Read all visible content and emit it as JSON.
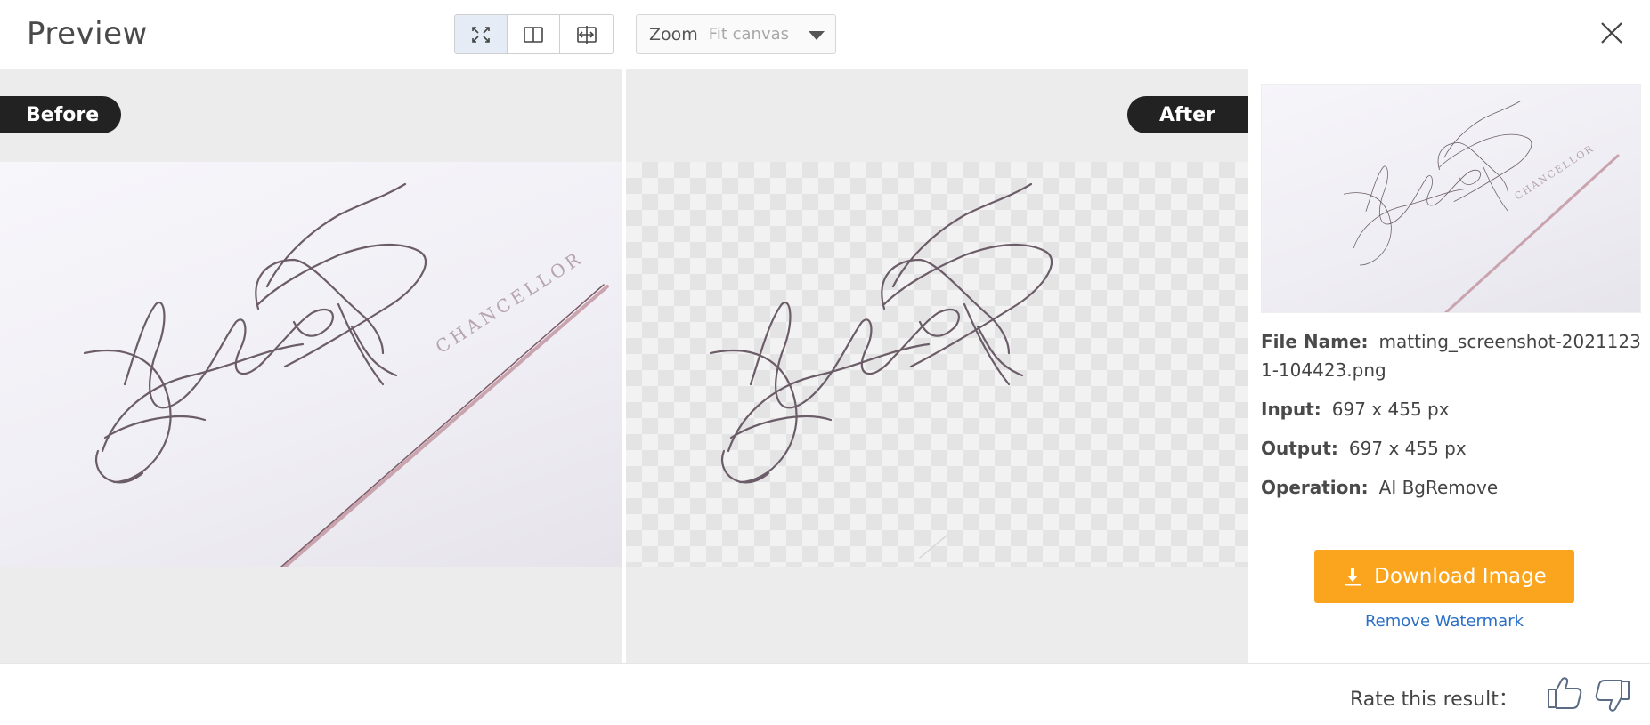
{
  "header": {
    "title": "Preview",
    "view_modes": [
      {
        "icon": "fullscreen-icon",
        "active": true
      },
      {
        "icon": "split-view-icon",
        "active": false
      },
      {
        "icon": "compare-slider-icon",
        "active": false
      }
    ],
    "zoom": {
      "label": "Zoom",
      "value": "Fit canvas"
    },
    "close_icon": "close-icon"
  },
  "panels": {
    "before_label": "Before",
    "after_label": "After",
    "image_text": "CHANCELLOR"
  },
  "info": {
    "file_name_key": "File Name:",
    "file_name_value": "matting_screenshot-20211231-104423.png",
    "input_key": "Input:",
    "input_value": "697 x 455 px",
    "output_key": "Output:",
    "output_value": "697 x 455 px",
    "operation_key": "Operation:",
    "operation_value": "AI BgRemove"
  },
  "actions": {
    "download_label": "Download Image",
    "remove_watermark_label": "Remove Watermark"
  },
  "footer": {
    "rate_label": "Rate this result："
  },
  "colors": {
    "accent": "#fba51f",
    "link": "#2b6fc7",
    "tag_bg": "#222222",
    "active_view": "#e5ecf6"
  }
}
